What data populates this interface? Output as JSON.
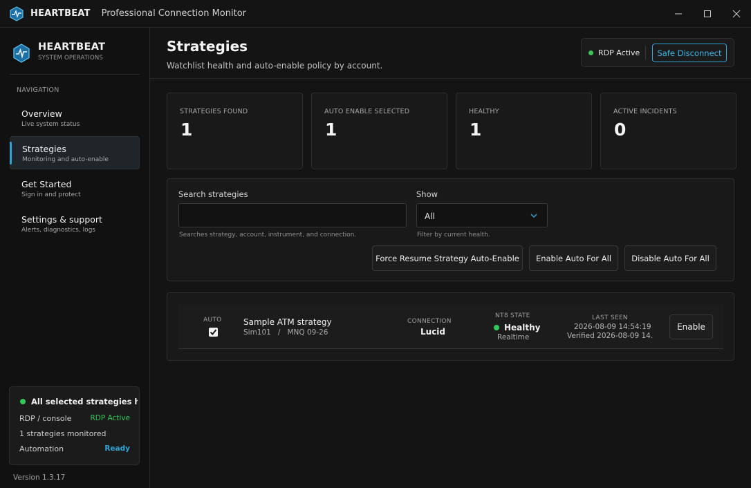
{
  "window": {
    "app_name": "HEARTBEAT",
    "title": "Professional Connection Monitor"
  },
  "sidebar": {
    "brand": {
      "name": "HEARTBEAT",
      "subtitle": "SYSTEM OPERATIONS"
    },
    "nav_title": "NAVIGATION",
    "items": [
      {
        "label": "Overview",
        "desc": "Live system status",
        "active": false
      },
      {
        "label": "Strategies",
        "desc": "Monitoring and auto-enable",
        "active": true
      },
      {
        "label": "Get Started",
        "desc": "Sign in and protect",
        "active": false
      },
      {
        "label": "Settings & support",
        "desc": "Alerts, diagnostics, logs",
        "active": false
      }
    ],
    "status": {
      "headline": "All selected strategies healthy",
      "rows": [
        {
          "label": "RDP / console",
          "value": "RDP Active"
        },
        {
          "label": "1 strategies monitored",
          "value": ""
        },
        {
          "label": "Automation",
          "value": "Ready"
        }
      ]
    },
    "version": "Version 1.3.17"
  },
  "header": {
    "title": "Strategies",
    "subtitle": "Watchlist health and auto-enable policy by account.",
    "rdp_status": "RDP Active",
    "safe_disconnect": "Safe Disconnect"
  },
  "stats": [
    {
      "label": "STRATEGIES FOUND",
      "value": "1"
    },
    {
      "label": "AUTO ENABLE SELECTED",
      "value": "1"
    },
    {
      "label": "HEALTHY",
      "value": "1"
    },
    {
      "label": "ACTIVE INCIDENTS",
      "value": "0"
    }
  ],
  "filters": {
    "search_label": "Search strategies",
    "search_value": "",
    "search_hint": "Searches strategy, account, instrument, and connection.",
    "show_label": "Show",
    "show_value": "All",
    "show_hint": "Filter by current health.",
    "actions": {
      "force_resume": "Force Resume Strategy Auto-Enable",
      "enable_all": "Enable Auto For All",
      "disable_all": "Disable Auto For All"
    }
  },
  "strategies": [
    {
      "auto_label": "AUTO",
      "auto_checked": true,
      "name": "Sample ATM strategy",
      "account": "Sim101",
      "instrument": "MNQ 09-26",
      "connection_label": "CONNECTION",
      "connection": "Lucid",
      "nt8_label": "NT8 STATE",
      "nt8_state": "Healthy",
      "nt8_sub": "Realtime",
      "last_seen_label": "LAST SEEN",
      "last_seen": "2026-08-09 14:54:19",
      "verified": "Verified 2026-08-09 14...",
      "action": "Enable"
    }
  ],
  "colors": {
    "accent": "#2fa4d8",
    "healthy": "#34c759",
    "background": "#141414",
    "card": "#191919"
  }
}
